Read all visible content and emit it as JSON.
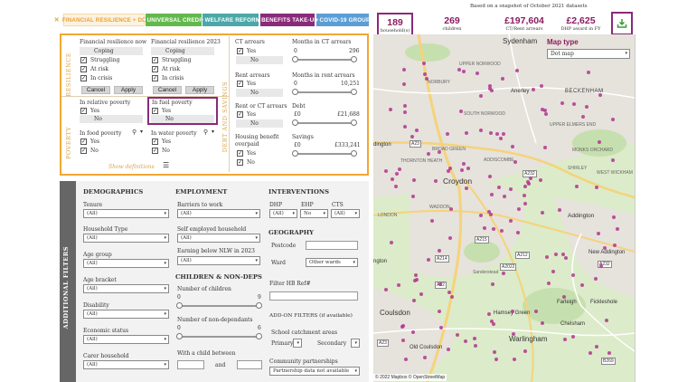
{
  "tabs": [
    {
      "label": "FINANCIAL RESILIENCE + DEBT",
      "color": "#fdf2e0",
      "text_color": "#e6a032"
    },
    {
      "label": "UNIVERSAL CREDIT",
      "color": "#63b84d"
    },
    {
      "label": "WELFARE REFORM",
      "color": "#4aa8a8"
    },
    {
      "label": "BENEFITS TAKE-UP",
      "color": "#8a2a7a"
    },
    {
      "label": "COVID-19 GROUP",
      "color": "#5a9ed6"
    }
  ],
  "snapshot_text": "Based on a snapshot of October 2021 datasets",
  "stats": [
    {
      "value": "189",
      "label": "household(s)"
    },
    {
      "value": "269",
      "label": "children"
    },
    {
      "value": "£197,604",
      "label": "CT/Rent arrears"
    },
    {
      "value": "£2,625",
      "label": "DHP award in FY"
    }
  ],
  "resilience": {
    "side_label": "RESILIENCE",
    "now_title": "Financial resilience now",
    "y2023_title": "Financial resilience 2023",
    "options": [
      "Coping",
      "Struggling",
      "At risk",
      "In crisis"
    ],
    "now_checked": [
      false,
      true,
      true,
      true
    ],
    "y2023_checked": [
      false,
      true,
      true,
      true
    ],
    "cancel": "Cancel",
    "apply": "Apply"
  },
  "poverty": {
    "side_label": "POVERTY",
    "relative_title": "In relative poverty",
    "fuel_title": "In fuel poverty",
    "food_title": "In food poverty",
    "water_title": "In water poverty",
    "yes": "Yes",
    "no": "No",
    "show_definitions": "Show definitions"
  },
  "debt": {
    "side_label": "DEBT AND SAVINGS",
    "ct_title": "CT arrears",
    "months_ct_title": "Months in CT arrears",
    "months_ct_min": "0",
    "months_ct_max": "296",
    "rent_title": "Rent arrears",
    "months_rent_title": "Months in rent arrears",
    "months_rent_min": "0",
    "months_rent_max": "10,251",
    "rent_or_ct_title": "Rent or CT arrears",
    "debt_title": "Debt",
    "debt_min": "£0",
    "debt_max": "£21,688",
    "hb_title_1": "Housing benefit",
    "hb_title_2": "overpaid",
    "savings_title": "Savings",
    "savings_min": "£0",
    "savings_max": "£333,241"
  },
  "additional": {
    "side_label": "ADDITIONAL FILTERS",
    "demographics": "DEMOGRAPHICS",
    "tenure": "Tenure",
    "household_type": "Household Type",
    "age_group": "Age group",
    "age_bracket": "Age bracket",
    "disability": "Disability",
    "economic_status": "Economic status",
    "carer_household": "Carer household",
    "all": "(All)",
    "employment": "EMPLOYMENT",
    "barriers": "Barriers to work",
    "self_employed": "Self employed household",
    "earning_below": "Earning below NLW in 2023",
    "children_nondeps": "CHILDREN & NON-DEPS",
    "num_children": "Number of children",
    "num_children_min": "0",
    "num_children_max": "9",
    "num_nondeps": "Number of non-dependants",
    "num_nondeps_min": "0",
    "num_nondeps_max": "6",
    "child_between": "With a child between",
    "and_text": "and",
    "interventions": "INTERVENTIONS",
    "dhp": "DHP",
    "ehp": "EHP",
    "cts": "CTS",
    "no_val": "No",
    "geography": "GEOGRAPHY",
    "postcode": "Postcode",
    "ward": "Ward",
    "ward_value": "Other wards",
    "filter_hb": "Filter HB Ref#",
    "addon": "ADD-ON FILTERS (if available)",
    "school": "School catchment areas",
    "primary": "Primary",
    "secondary": "Secondary",
    "community": "Community partnerships",
    "partnership_value": "Partnership data not available"
  },
  "map": {
    "type_title": "Map type",
    "type_value": "Dot map",
    "attribution": "© 2022 Mapbox  © OpenStreetMap",
    "places": [
      "Sydenham",
      "Anerley",
      "BECKENHAM",
      "UPPER NORWOOD",
      "SOUTH NORWOOD",
      "UPPER ELMERS END",
      "MONKS ORCHARD",
      "ADDISCOMBE",
      "SHIRLEY",
      "WEST WICKHAM",
      "Croydon",
      "Addington",
      "New Addington",
      "Sanderstead",
      "Coulsdon",
      "Hamsey Green",
      "Chelsham",
      "Warlingham",
      "Old Coulsdon",
      "Farleigh",
      "Fickleshole",
      "THORNTON HEATH",
      "BROAD GREEN",
      "WADDON",
      "NORBURY",
      "LONDON",
      "dington",
      "ngton"
    ],
    "roads": [
      "A23",
      "A232",
      "A212",
      "A22",
      "A2022",
      "B269",
      "A214",
      "A215",
      "A23",
      "A232"
    ]
  },
  "accent": "#8a2a7a",
  "orange": "#f2a732"
}
